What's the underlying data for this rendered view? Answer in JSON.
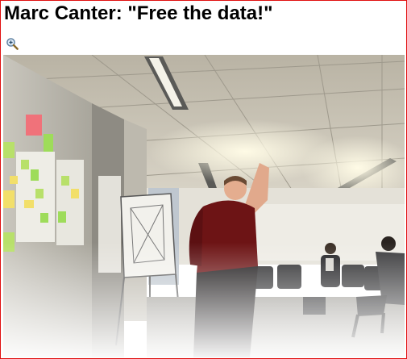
{
  "page": {
    "title": "Marc Canter: \"Free the data!\""
  },
  "toolbar": {
    "zoom_icon": "magnifier-zoom-icon"
  },
  "photo": {
    "subject": "photograph"
  },
  "colors": {
    "border": "#e01010",
    "title": "#000000"
  }
}
